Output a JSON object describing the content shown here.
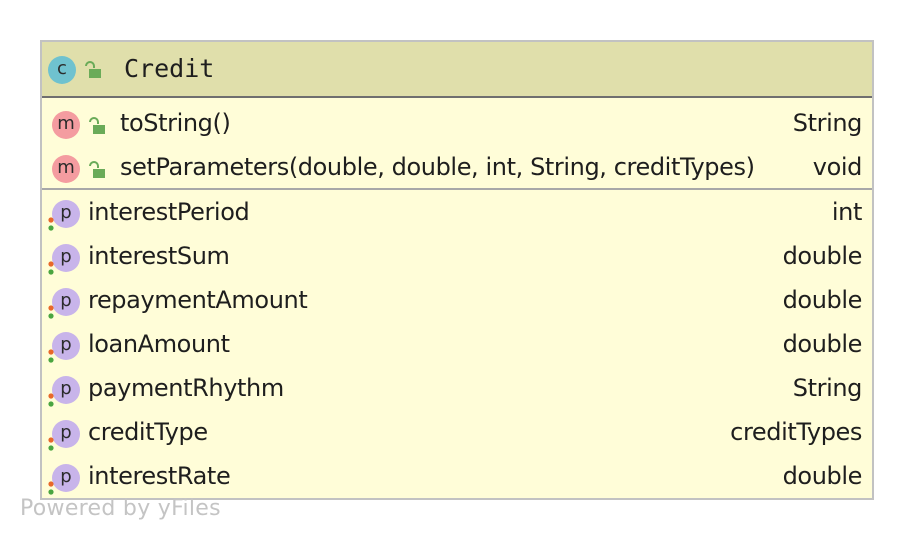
{
  "class_node": {
    "kind_letter": "c",
    "name": "Credit"
  },
  "methods": [
    {
      "kind_letter": "m",
      "name": "toString()",
      "type": "String"
    },
    {
      "kind_letter": "m",
      "name": "setParameters(double, double, int, String, creditTypes)",
      "type": "void"
    }
  ],
  "properties": [
    {
      "kind_letter": "p",
      "name": "interestPeriod",
      "type": "int"
    },
    {
      "kind_letter": "p",
      "name": "interestSum",
      "type": "double"
    },
    {
      "kind_letter": "p",
      "name": "repaymentAmount",
      "type": "double"
    },
    {
      "kind_letter": "p",
      "name": "loanAmount",
      "type": "double"
    },
    {
      "kind_letter": "p",
      "name": "paymentRhythm",
      "type": "String"
    },
    {
      "kind_letter": "p",
      "name": "creditType",
      "type": "creditTypes"
    },
    {
      "kind_letter": "p",
      "name": "interestRate",
      "type": "double"
    }
  ],
  "watermark": "Powered by yFiles",
  "colors": {
    "header_bg": "#e0dfab",
    "body_bg": "#fffdd8",
    "class_badge": "#6fc2cf",
    "method_badge": "#f49ca0",
    "property_badge": "#c8b4ea",
    "public_lock": "#6aab58",
    "getter_dot": "#e8682a",
    "setter_dot": "#4aa540"
  }
}
